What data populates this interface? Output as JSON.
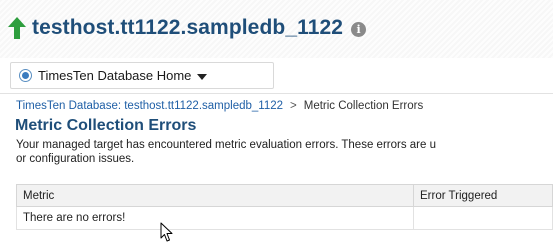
{
  "target": {
    "title": "testhost.tt1122.sampledb_1122",
    "status_color": "#2e9e3e",
    "info_glyph": "i"
  },
  "menu": {
    "label": "TimesTen Database Home"
  },
  "breadcrumb": {
    "link": "TimesTen Database: testhost.tt1122.sampledb_1122",
    "separator": ">",
    "current": "Metric Collection Errors"
  },
  "page": {
    "title": "Metric Collection Errors",
    "description_line1": "Your managed target has encountered metric evaluation errors. These errors are u",
    "description_line2": "or configuration issues."
  },
  "table": {
    "columns": [
      "Metric",
      "Error Triggered"
    ],
    "empty_message": "There are no errors!"
  }
}
